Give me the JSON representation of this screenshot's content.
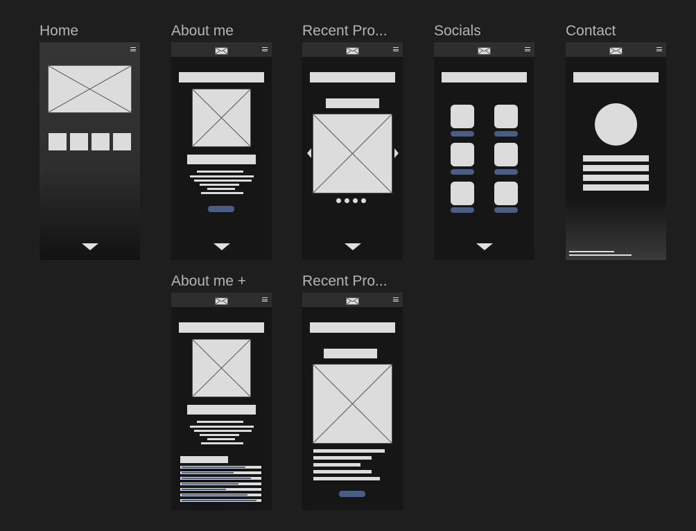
{
  "frames": {
    "home": {
      "label": "Home"
    },
    "about": {
      "label": "About me"
    },
    "projects": {
      "label": "Recent Pro..."
    },
    "socials": {
      "label": "Socials"
    },
    "contact": {
      "label": "Contact"
    },
    "about_plus": {
      "label": "About me +"
    },
    "projects_detail": {
      "label": "Recent Pro..."
    }
  },
  "icons": {
    "mail": "mail-icon",
    "menu": "hamburger-menu-icon",
    "scroll": "chevron-down-icon"
  },
  "colors": {
    "canvas": "#1e1e1e",
    "frame": "#161616",
    "placeholder": "#dcdcdc",
    "accent": "#4a5e85"
  }
}
